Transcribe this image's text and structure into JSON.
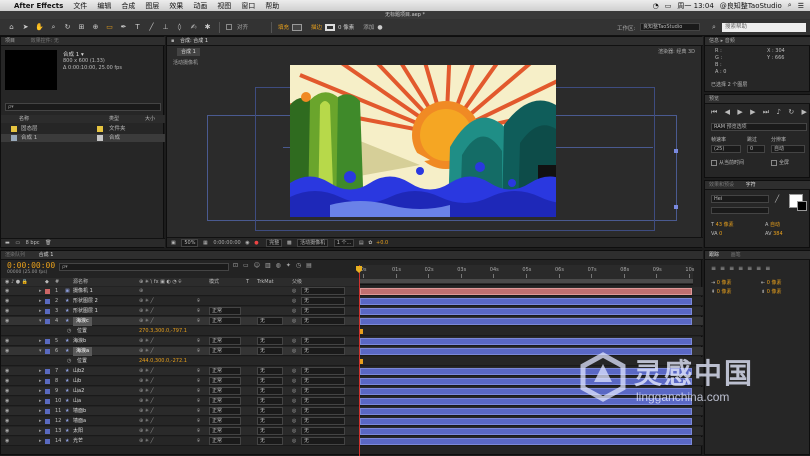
{
  "menubar": {
    "app_name": "After Effects",
    "items": [
      "文件",
      "编辑",
      "合成",
      "图层",
      "效果",
      "动画",
      "视图",
      "窗口",
      "帮助"
    ],
    "right": {
      "user": "@良知整TaoStudio",
      "datetime": "周一 13:04"
    }
  },
  "window_title": "无标题项目.aep *",
  "toolbar": {
    "checkbox_align": "对齐",
    "fill": "填充",
    "stroke": "描边",
    "stroke_px": "0 像素",
    "add": "添加",
    "workspace_label": "工作区:",
    "workspace_value": "良知整TaoStudio",
    "search_placeholder": "搜索帮助"
  },
  "project": {
    "tab": "项目",
    "tab2": "效果控件: 无",
    "comp_name": "合成 1 ▾",
    "comp_info1": "800 x 600 (1.33)",
    "comp_info2": "Δ 0:00:10:00, 25.00 fps",
    "col_name": "名称",
    "col_type": "类型",
    "col_size": "大小",
    "items": [
      {
        "name": "固态层",
        "type": "文件夹",
        "color": "#e6c440"
      },
      {
        "name": "合成 1",
        "type": "合成",
        "color": "#c6c6c6"
      }
    ],
    "bpc": "8 bpc"
  },
  "comp_view": {
    "tab_label": "合成: 合成 1",
    "crumb": "合成 1",
    "renderer_label": "渲染器:",
    "renderer_value": "经典 3D",
    "active_camera": "活动摄像机",
    "zoom": "50%",
    "time": "0:00:00:00",
    "quality": "完整",
    "camera": "活动摄像机",
    "views": "1 个...",
    "exposure": "+0.0"
  },
  "info_panel": {
    "r": "R :",
    "g": "G :",
    "b": "B :",
    "a": "A : 0",
    "x": "X : 304",
    "y": "Y : 666",
    "selected": "已选择 2 个图层"
  },
  "preview_panel": {
    "ram": "RAM 预览选项",
    "framerate_label": "帧速率",
    "skip_label": "跳过",
    "res_label": "分辨率",
    "framerate": "(25)",
    "skip": "0",
    "res": "自动",
    "from_current": "从当前时间",
    "fullscreen": "全屏"
  },
  "char_panel": {
    "tab1": "效果和预设",
    "tab2": "字符",
    "font": "Hei",
    "size": "43 像素",
    "leading": "自动",
    "kerning": "0",
    "tracking": "384"
  },
  "align_panel": {
    "tab1": "跟踪",
    "tab2": "画笔",
    "px1": "0 像素",
    "px2": "0 像素",
    "px3": "0 像素",
    "px4": "0 像素"
  },
  "timeline": {
    "tab1": "渲染队列",
    "tab2": "合成 1",
    "timecode": "0:00:00:00",
    "fps": "00000 (25.00 fps)",
    "search_placeholder": "ρ▾",
    "col_source": "源名称",
    "col_mode": "模式",
    "col_t": "T",
    "col_trkmat": "TrkMat",
    "col_parent": "父级",
    "ticks": [
      "0s",
      "01s",
      "02s",
      "03s",
      "04s",
      "05s",
      "06s",
      "07s",
      "08s",
      "09s",
      "10s"
    ],
    "layers": [
      {
        "num": "1",
        "name": "摄像机 1",
        "color": "#c66",
        "mode": "",
        "trk": "",
        "parent": "无",
        "kind": "camera"
      },
      {
        "num": "2",
        "name": "形状图层 2",
        "color": "#5a6ac0",
        "mode": "",
        "trk": "",
        "parent": "无",
        "kind": "shape"
      },
      {
        "num": "3",
        "name": "形状图层 1",
        "color": "#5a6ac0",
        "mode": "正常",
        "trk": "",
        "parent": "无",
        "kind": "shape"
      },
      {
        "num": "4",
        "name": "海浪c",
        "color": "#5a6ac0",
        "mode": "正常",
        "trk": "无",
        "parent": "无",
        "kind": "selected",
        "prop": "位置",
        "propval": "270.3,300.0,-797.1"
      },
      {
        "num": "5",
        "name": "海浪b",
        "color": "#5a6ac0",
        "mode": "正常",
        "trk": "无",
        "parent": "无",
        "kind": "shape"
      },
      {
        "num": "6",
        "name": "海浪a",
        "color": "#5a6ac0",
        "mode": "正常",
        "trk": "无",
        "parent": "无",
        "kind": "selected",
        "prop": "位置",
        "propval": "244.0,300.0,-272.1"
      },
      {
        "num": "7",
        "name": "山b2",
        "color": "#5a6ac0",
        "mode": "正常",
        "trk": "无",
        "parent": "无",
        "kind": "shape"
      },
      {
        "num": "8",
        "name": "山b",
        "color": "#5a6ac0",
        "mode": "正常",
        "trk": "无",
        "parent": "无",
        "kind": "shape"
      },
      {
        "num": "9",
        "name": "山a2",
        "color": "#5a6ac0",
        "mode": "正常",
        "trk": "无",
        "parent": "无",
        "kind": "shape"
      },
      {
        "num": "10",
        "name": "山a",
        "color": "#5a6ac0",
        "mode": "正常",
        "trk": "无",
        "parent": "无",
        "kind": "shape"
      },
      {
        "num": "11",
        "name": "墙面b",
        "color": "#5a6ac0",
        "mode": "正常",
        "trk": "无",
        "parent": "无",
        "kind": "shape"
      },
      {
        "num": "12",
        "name": "墙面a",
        "color": "#5a6ac0",
        "mode": "正常",
        "trk": "无",
        "parent": "无",
        "kind": "shape"
      },
      {
        "num": "13",
        "name": "太阳",
        "color": "#5a6ac0",
        "mode": "正常",
        "trk": "无",
        "parent": "无",
        "kind": "shape"
      },
      {
        "num": "14",
        "name": "光芒",
        "color": "#5a6ac0",
        "mode": "正常",
        "trk": "无",
        "parent": "无",
        "kind": "shape"
      }
    ]
  },
  "watermark": {
    "cn": "灵感中国",
    "en": "lingganchina.com"
  }
}
